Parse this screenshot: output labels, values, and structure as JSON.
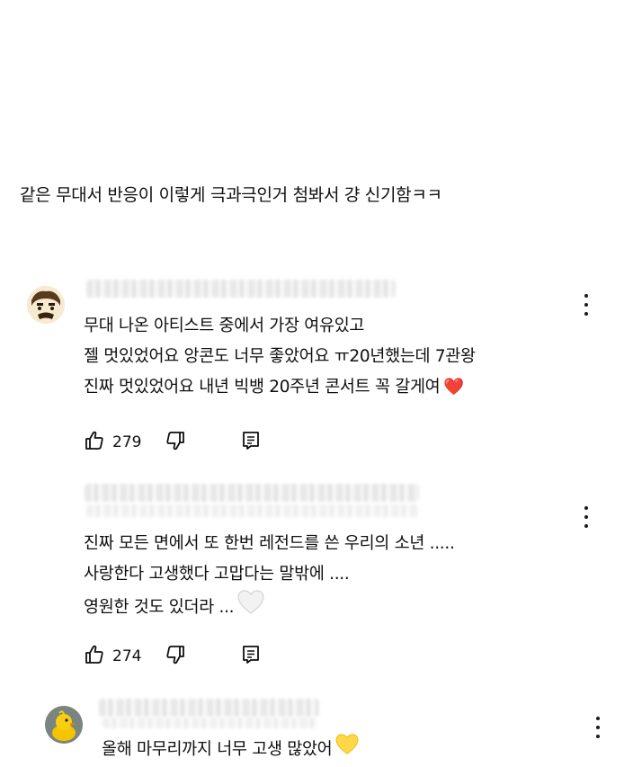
{
  "caption": "같은 무대서 반응이 이렇게 극과극인거 첨봐서 걍 신기함ㅋㅋ",
  "comments": [
    {
      "lines": [
        "무대 나온 아티스트 중에서 가장 여유있고",
        "젤 멋있었어요 앙콘도 너무 좋았어요 ㅠ20년했는데 7관왕",
        "진짜 멋있었어요 내년 빅뱅 20주년 콘서트 꼭 갈게여"
      ],
      "emoji": "❤️",
      "likes": "279"
    },
    {
      "lines": [
        "진짜 모든 면에서 또 한번 레전드를 쓴 우리의 소년 .....",
        "사랑한다 고생했다 고맙다는 말밖에 ....",
        "영원한 것도 있더라 ..."
      ],
      "emoji": "🤍",
      "likes": "274"
    },
    {
      "lines": [
        "올해 마무리까지 너무 고생 많았어"
      ],
      "emoji": "💛"
    }
  ],
  "icons": {
    "like": "thumbs-up-icon",
    "dislike": "thumbs-down-icon",
    "reply": "reply-icon",
    "more": "more-vertical-icon"
  }
}
